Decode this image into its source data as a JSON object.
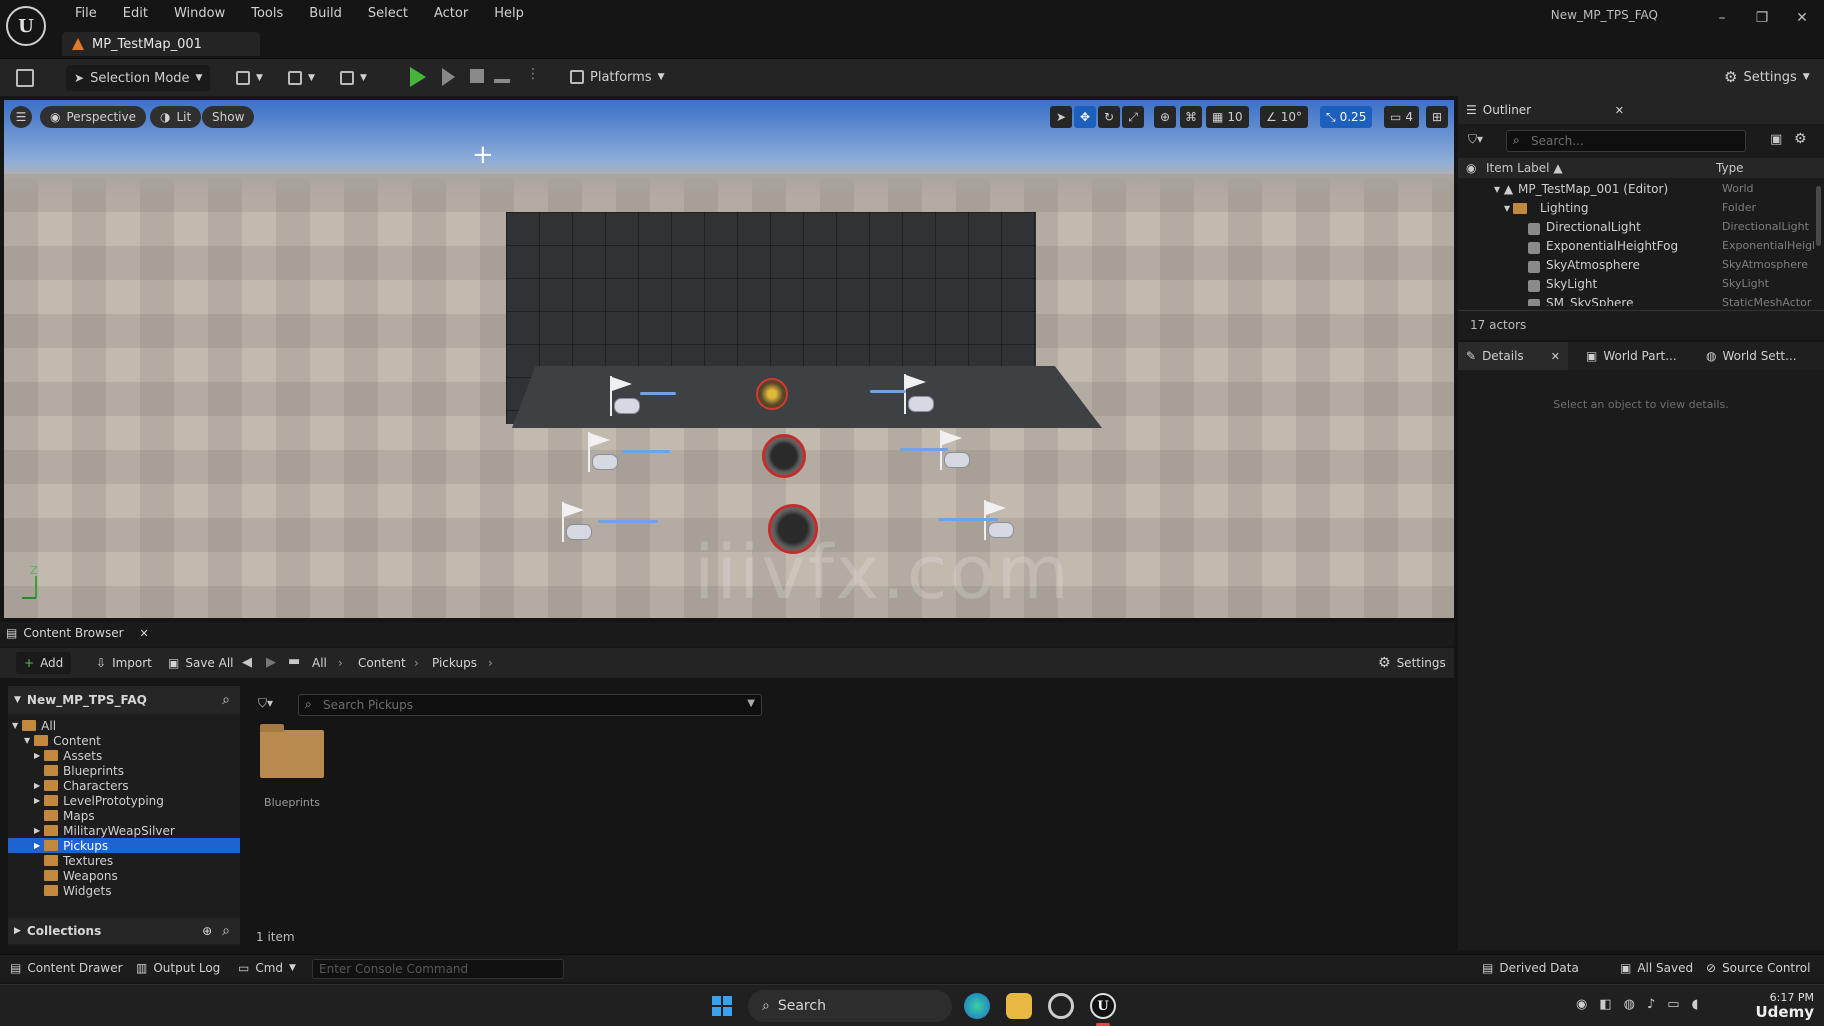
{
  "app": {
    "logo": "U",
    "window_title": "New_MP_TPS_FAQ",
    "map_tab": "MP_TestMap_001",
    "menu": [
      "File",
      "Edit",
      "Window",
      "Tools",
      "Build",
      "Select",
      "Actor",
      "Help"
    ],
    "controls": {
      "minimize": "–",
      "restore": "❐",
      "close": "✕"
    }
  },
  "toolbar": {
    "selection_mode": "Selection Mode",
    "platforms": "Platforms",
    "settings": "Settings"
  },
  "viewport": {
    "perspective": "Perspective",
    "lit": "Lit",
    "show": "Show",
    "grid_snap": "10",
    "rotation_snap": "10°",
    "scale_snap": "0.25",
    "camera_speed": "4",
    "axis_z": "Z",
    "watermark": "iiivfx.com"
  },
  "outliner": {
    "tab": "Outliner",
    "search_placeholder": "Search...",
    "col_label": "Item Label ▲",
    "col_type": "Type",
    "rows": [
      {
        "label": "MP_TestMap_001 (Editor)",
        "type": "World"
      },
      {
        "label": "Lighting",
        "type": "Folder"
      },
      {
        "label": "DirectionalLight",
        "type": "DirectionalLight"
      },
      {
        "label": "ExponentialHeightFog",
        "type": "ExponentialHeightFog"
      },
      {
        "label": "SkyAtmosphere",
        "type": "SkyAtmosphere"
      },
      {
        "label": "SkyLight",
        "type": "SkyLight"
      },
      {
        "label": "SM_SkySphere",
        "type": "StaticMeshActor"
      }
    ],
    "actor_count": "17 actors"
  },
  "details": {
    "tabs": [
      "Details",
      "World Part...",
      "World Sett..."
    ],
    "empty": "Select an object to view details."
  },
  "content_browser": {
    "tab": "Content Browser",
    "add": "Add",
    "import": "Import",
    "save_all": "Save All",
    "breadcrumb": [
      "All",
      "Content",
      "Pickups"
    ],
    "settings": "Settings",
    "project": "New_MP_TPS_FAQ",
    "search_placeholder": "Search Pickups",
    "tree": [
      {
        "label": "All",
        "indent": 0
      },
      {
        "label": "Content",
        "indent": 1
      },
      {
        "label": "Assets",
        "indent": 2
      },
      {
        "label": "Blueprints",
        "indent": 2
      },
      {
        "label": "Characters",
        "indent": 2
      },
      {
        "label": "LevelPrototyping",
        "indent": 2
      },
      {
        "label": "Maps",
        "indent": 2
      },
      {
        "label": "MilitaryWeapSilver",
        "indent": 2
      },
      {
        "label": "Pickups",
        "indent": 2
      },
      {
        "label": "Textures",
        "indent": 2
      },
      {
        "label": "Weapons",
        "indent": 2
      },
      {
        "label": "Widgets",
        "indent": 2
      }
    ],
    "selected_folder": "Pickups",
    "collections": "Collections",
    "asset": "Blueprints",
    "item_count": "1 item"
  },
  "statusbar": {
    "content_drawer": "Content Drawer",
    "output_log": "Output Log",
    "cmd": "Cmd",
    "console_placeholder": "Enter Console Command",
    "derived_data": "Derived Data",
    "all_saved": "All Saved",
    "source_control": "Source Control"
  },
  "taskbar": {
    "search": "Search",
    "time": "6:17 PM",
    "watermark": "Udemy"
  },
  "colors": {
    "accent": "#1e63d0",
    "play": "#46b53a",
    "folder": "#c2893e",
    "panel": "#1b1b1b"
  }
}
